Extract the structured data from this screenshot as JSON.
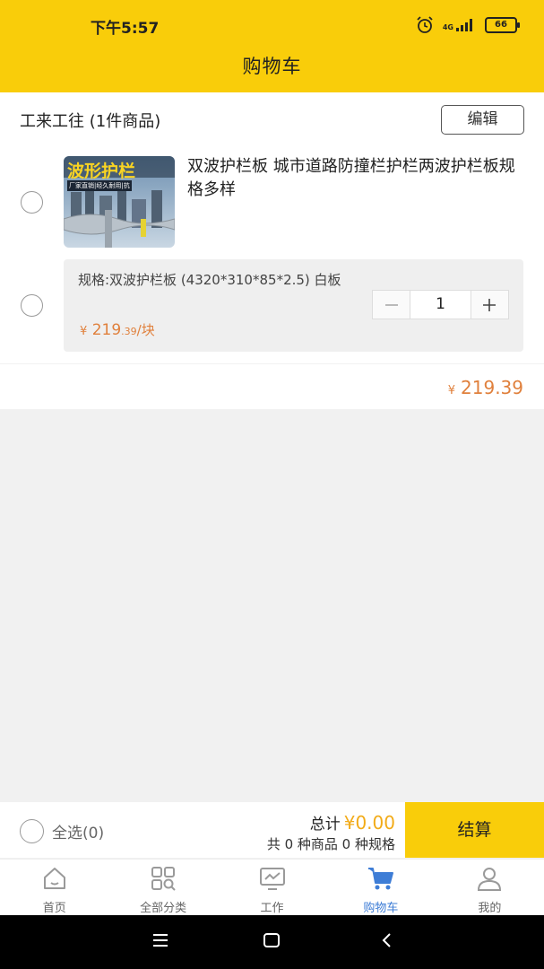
{
  "status": {
    "time": "下午5:57",
    "network": "4G",
    "battery": "66"
  },
  "header": {
    "title": "购物车"
  },
  "shop": {
    "name": "工来工往 (1件商品)",
    "edit_label": "编辑",
    "product": {
      "title": "双波护栏板 城市道路防撞栏护栏两波护栏板规格多样",
      "thumb_text": "波形护栏",
      "thumb_subtext": "厂家直销|经久耐用|抗",
      "spec": "规格:双波护栏板 (4320*310*85*2.5) 白板",
      "price_currency": "¥",
      "price_main": "219",
      "price_decimal": ".39",
      "price_unit": "/块",
      "quantity": "1"
    },
    "subtotal_currency": "¥",
    "subtotal": "219.39"
  },
  "bottom": {
    "select_all": "全选(0)",
    "total_label": "总计",
    "total_amount": "¥0.00",
    "summary": "共 0 种商品 0 种规格",
    "checkout": "结算"
  },
  "tabs": [
    {
      "label": "首页",
      "icon": "home-icon"
    },
    {
      "label": "全部分类",
      "icon": "category-icon"
    },
    {
      "label": "工作",
      "icon": "monitor-icon"
    },
    {
      "label": "购物车",
      "icon": "cart-icon",
      "active": true
    },
    {
      "label": "我的",
      "icon": "user-icon"
    }
  ],
  "colors": {
    "brand_yellow": "#f9cd0a",
    "price_orange": "#e0803c",
    "active_blue": "#3e7dd6"
  }
}
